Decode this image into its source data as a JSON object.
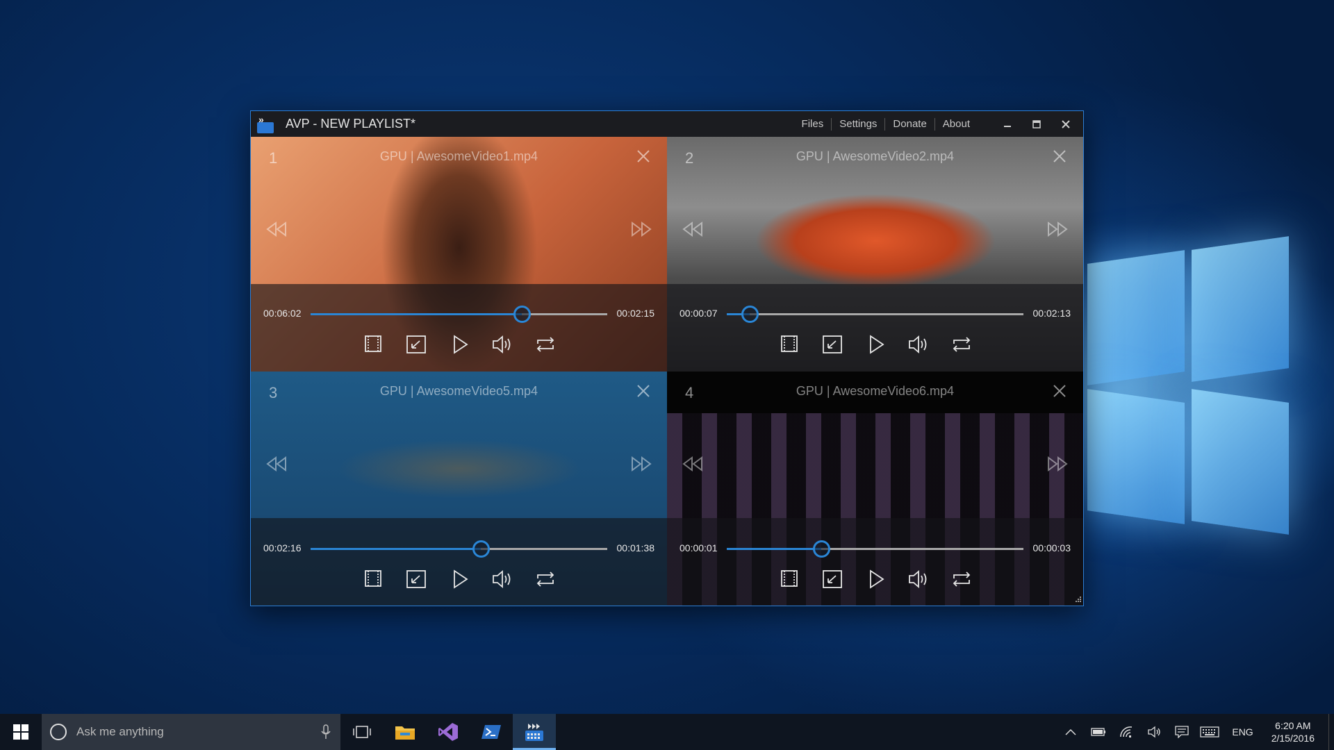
{
  "window": {
    "title": "AVP - NEW PLAYLIST*",
    "menu": [
      "Files",
      "Settings",
      "Donate",
      "About"
    ]
  },
  "panels": [
    {
      "number": "1",
      "title": "GPU | AwesomeVideo1.mp4",
      "time_elapsed": "00:06:02",
      "time_remaining": "00:02:15",
      "progress": 0.713
    },
    {
      "number": "2",
      "title": "GPU | AwesomeVideo2.mp4",
      "time_elapsed": "00:00:07",
      "time_remaining": "00:02:13",
      "progress": 0.078
    },
    {
      "number": "3",
      "title": "GPU | AwesomeVideo5.mp4",
      "time_elapsed": "00:02:16",
      "time_remaining": "00:01:38",
      "progress": 0.573
    },
    {
      "number": "4",
      "title": "GPU | AwesomeVideo6.mp4",
      "time_elapsed": "00:00:01",
      "time_remaining": "00:00:03",
      "progress": 0.318
    }
  ],
  "taskbar": {
    "search_placeholder": "Ask me anything",
    "language": "ENG",
    "time": "6:20 AM",
    "date": "2/15/2016"
  },
  "colors": {
    "accent": "#2a86d6",
    "window_border": "#2d7fd6",
    "taskbar": "#0e1520"
  },
  "icons": [
    "app-logo-icon",
    "minimize-icon",
    "maximize-icon",
    "close-icon",
    "rewind-icon",
    "fast-forward-icon",
    "aspect-ratio-icon",
    "fullscreen-icon",
    "play-icon",
    "volume-icon",
    "repeat-icon",
    "windows-start-icon",
    "microphone-icon",
    "task-view-icon",
    "file-explorer-icon",
    "visual-studio-icon",
    "powershell-icon",
    "chevron-up-icon",
    "battery-icon",
    "wifi-icon",
    "speaker-icon",
    "notification-icon",
    "keyboard-icon"
  ]
}
